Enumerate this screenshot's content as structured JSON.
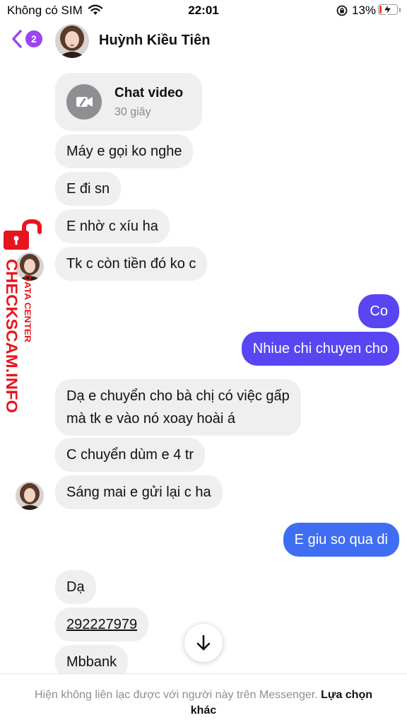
{
  "status_bar": {
    "carrier": "Không có SIM",
    "time": "22:01",
    "battery": "13%",
    "battery_level": 0.13
  },
  "header": {
    "back_count": "2",
    "contact_name": "Huỳnh Kiều Tiên"
  },
  "call": {
    "title": "Chat video",
    "duration": "30 giây"
  },
  "messages": [
    {
      "text": "Máy e gọi ko nghe",
      "from": "contact"
    },
    {
      "text": "E đi sn",
      "from": "contact"
    },
    {
      "text": "E nhờ c xíu ha",
      "from": "contact"
    },
    {
      "text": "Tk c còn tiền đó ko c",
      "from": "contact"
    },
    {
      "text": "Co",
      "from": "me"
    },
    {
      "text": "Nhiue chi chuyen cho",
      "from": "me"
    },
    {
      "line1": "Dạ e chuyển cho bà chị có việc gấp",
      "line2": "mà tk e vào nó xoay hoài á",
      "from": "contact"
    },
    {
      "text": "C chuyển dùm e 4 tr",
      "from": "contact"
    },
    {
      "text": "Sáng mai e gửi lại c ha",
      "from": "contact"
    },
    {
      "text": "E giu so qua di",
      "from": "me"
    },
    {
      "text": "Dạ",
      "from": "contact"
    },
    {
      "text": "292227979",
      "from": "contact"
    },
    {
      "text": "Mbbank",
      "from": "contact"
    }
  ],
  "footer": {
    "notice": "Hiện không liên lạc được với người này trên Messenger. ",
    "link": "Lựa chọn khác"
  },
  "watermark": {
    "main": "CHECKSCAM.INFO",
    "sub": "DATA CENTER"
  },
  "icons": {
    "wifi": "wifi-icon",
    "rotation_lock": "rotation-lock-icon",
    "battery": "battery-icon",
    "back": "chevron-left-icon",
    "call": "video-call-missed-icon",
    "scroll": "arrow-down-icon",
    "lock": "lock-icon"
  },
  "colors": {
    "accent": "#9d43f5",
    "outgoing_purple": "#5a45f2",
    "outgoing_blue": "#3f6ef2",
    "incoming": "#efefef",
    "watermark": "#e8141e"
  }
}
